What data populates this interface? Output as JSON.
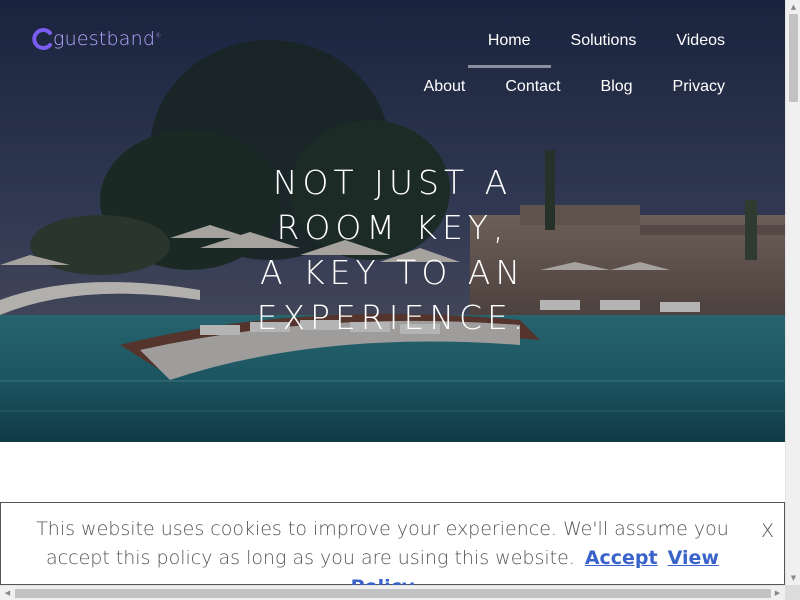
{
  "brand": {
    "logo_text": "guestband",
    "logo_mark": "guestband-logo-icon",
    "trademark": "®"
  },
  "nav": {
    "row1": [
      {
        "label": "Home",
        "active": true
      },
      {
        "label": "Solutions"
      },
      {
        "label": "Videos"
      }
    ],
    "row2": [
      {
        "label": "About"
      },
      {
        "label": "Contact"
      },
      {
        "label": "Blog"
      },
      {
        "label": "Privacy"
      }
    ]
  },
  "hero": {
    "lines": [
      "NOT JUST A",
      "ROOM KEY,",
      "A KEY TO AN",
      "EXPERIENCE."
    ]
  },
  "cookie": {
    "message": "This website uses cookies to improve your experience. We'll assume you accept this policy as long as you are using this website.",
    "accept_label": "Accept",
    "policy_label": "View Policy",
    "close_label": "X"
  },
  "scrollbar": {
    "up_icon": "▲",
    "down_icon": "▼",
    "left_icon": "◀",
    "right_icon": "▶"
  },
  "colors": {
    "brand": "#8f7cf0",
    "link": "#3a63c9",
    "nav_underline": "#8a8f9c"
  }
}
